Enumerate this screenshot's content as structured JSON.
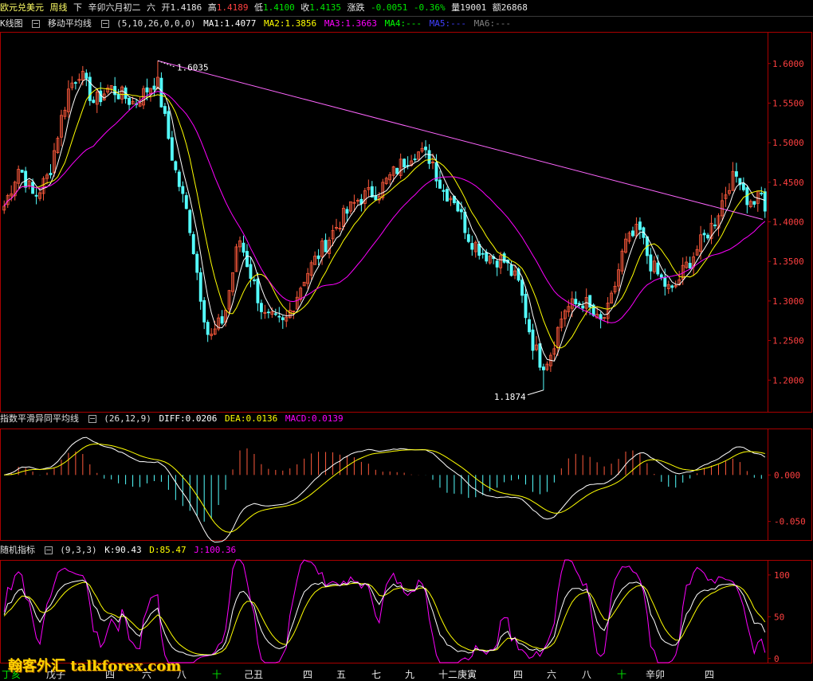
{
  "header": {
    "symbol": "欧元兑美元",
    "period": "周线",
    "flag": "下",
    "date": "辛卯六月初二",
    "weekday": "六",
    "open_label": "开",
    "open": "1.4186",
    "high_label": "高",
    "high": "1.4189",
    "low_label": "低",
    "low": "1.4100",
    "close_label": "收",
    "close": "1.4135",
    "change_label": "涨跌",
    "change": "-0.0051",
    "change_pct": "-0.36%",
    "volume_label": "量",
    "volume": "19001",
    "amount_label": "额",
    "amount": "26868"
  },
  "main_panel": {
    "chart_name": "K线图",
    "indicator_name": "移动平均线",
    "params": "(5,10,26,0,0,0)",
    "ma1": "MA1:1.4077",
    "ma2": "MA2:1.3856",
    "ma3": "MA3:1.3663",
    "ma4": "MA4:---",
    "ma5": "MA5:---",
    "ma6": "MA6:---",
    "high_marker": "1.6035",
    "low_marker": "1.1874"
  },
  "macd_panel": {
    "name": "指数平滑异同平均线",
    "params": "(26,12,9)",
    "diff": "DIFF:0.0206",
    "dea": "DEA:0.0136",
    "macd": "MACD:0.0139"
  },
  "kdj_panel": {
    "name": "随机指标",
    "params": "(9,3,3)",
    "k": "K:90.43",
    "d": "D:85.47",
    "j": "J:100.36"
  },
  "x_axis_labels": [
    "丁亥",
    "戊子",
    "四",
    "六",
    "八",
    "十",
    "己丑",
    "四",
    "五",
    "七",
    "九",
    "十二庚寅",
    "四",
    "六",
    "八",
    "十",
    "辛卯",
    "四"
  ],
  "watermark": "翰客外汇 talkforex.com",
  "colors": {
    "up": "#ff5a3c",
    "down": "#54ffff",
    "ma1": "#ffffff",
    "ma2": "#ffff00",
    "ma3": "#ff00ff",
    "trendline": "#ff66ff",
    "grid_frame": "#aa0000",
    "axis_text": "#ff4040",
    "header_up": "#ff4040",
    "header_down": "#00e600",
    "header_label": "#e8e8e8",
    "macd_dea": "#ffff00",
    "kdj_j": "#ff00ff"
  },
  "chart_data": [
    {
      "type": "candlestick",
      "title": "K线图 移动平均线",
      "ylim": [
        1.16,
        1.64
      ],
      "y_ticks": [
        1.2,
        1.25,
        1.3,
        1.35,
        1.4,
        1.45,
        1.5,
        1.55,
        1.6
      ],
      "annotations": [
        {
          "text": "1.6035",
          "value": 1.6035
        },
        {
          "text": "1.1874",
          "value": 1.1874
        }
      ],
      "trendline": [
        [
          0.308,
          1.6035
        ],
        [
          0.965,
          1.403
        ]
      ],
      "anchors": [
        [
          0.0,
          1.42
        ],
        [
          0.03,
          1.47
        ],
        [
          0.06,
          1.43
        ],
        [
          0.09,
          1.46
        ],
        [
          0.11,
          1.52
        ],
        [
          0.13,
          1.57
        ],
        [
          0.15,
          1.59
        ],
        [
          0.18,
          1.55
        ],
        [
          0.21,
          1.57
        ],
        [
          0.26,
          1.55
        ],
        [
          0.305,
          1.58
        ],
        [
          0.34,
          1.47
        ],
        [
          0.37,
          1.4
        ],
        [
          0.395,
          1.3
        ],
        [
          0.41,
          1.25
        ],
        [
          0.44,
          1.28
        ],
        [
          0.47,
          1.38
        ],
        [
          0.49,
          1.34
        ],
        [
          0.52,
          1.28
        ],
        [
          0.56,
          1.27
        ],
        [
          0.6,
          1.33
        ],
        [
          0.64,
          1.37
        ],
        [
          0.67,
          1.4
        ],
        [
          0.71,
          1.43
        ],
        [
          0.75,
          1.44
        ],
        [
          0.79,
          1.47
        ],
        [
          0.82,
          1.49
        ],
        [
          0.855,
          1.48
        ],
        [
          0.875,
          1.44
        ],
        [
          0.9,
          1.43
        ],
        [
          0.93,
          1.38
        ],
        [
          0.96,
          1.36
        ],
        [
          1.0,
          1.35
        ],
        [
          1.03,
          1.32
        ],
        [
          1.055,
          1.25
        ],
        [
          1.075,
          1.22
        ],
        [
          1.09,
          1.23
        ],
        [
          1.12,
          1.29
        ],
        [
          1.16,
          1.3
        ],
        [
          1.19,
          1.27
        ],
        [
          1.21,
          1.29
        ],
        [
          1.24,
          1.37
        ],
        [
          1.27,
          1.39
        ],
        [
          1.29,
          1.35
        ],
        [
          1.31,
          1.33
        ],
        [
          1.335,
          1.31
        ],
        [
          1.36,
          1.34
        ],
        [
          1.39,
          1.37
        ],
        [
          1.42,
          1.4
        ],
        [
          1.45,
          1.45
        ],
        [
          1.47,
          1.46
        ],
        [
          1.49,
          1.42
        ],
        [
          1.515,
          1.44
        ],
        [
          1.53,
          1.4135
        ]
      ]
    },
    {
      "type": "line",
      "title": "指数平滑异同平均线",
      "series_names": [
        "DIFF",
        "DEA",
        "MACD"
      ],
      "ylim": [
        -0.07,
        0.05
      ],
      "y_ticks": [
        0.0,
        -0.05
      ],
      "tick_labels": [
        "0.000",
        "-0.050"
      ]
    },
    {
      "type": "line",
      "title": "随机指标",
      "series_names": [
        "K",
        "D",
        "J"
      ],
      "ylim": [
        -5,
        118
      ],
      "y_ticks": [
        0,
        50,
        100
      ],
      "tick_labels": [
        "0",
        "50",
        "100"
      ]
    }
  ]
}
